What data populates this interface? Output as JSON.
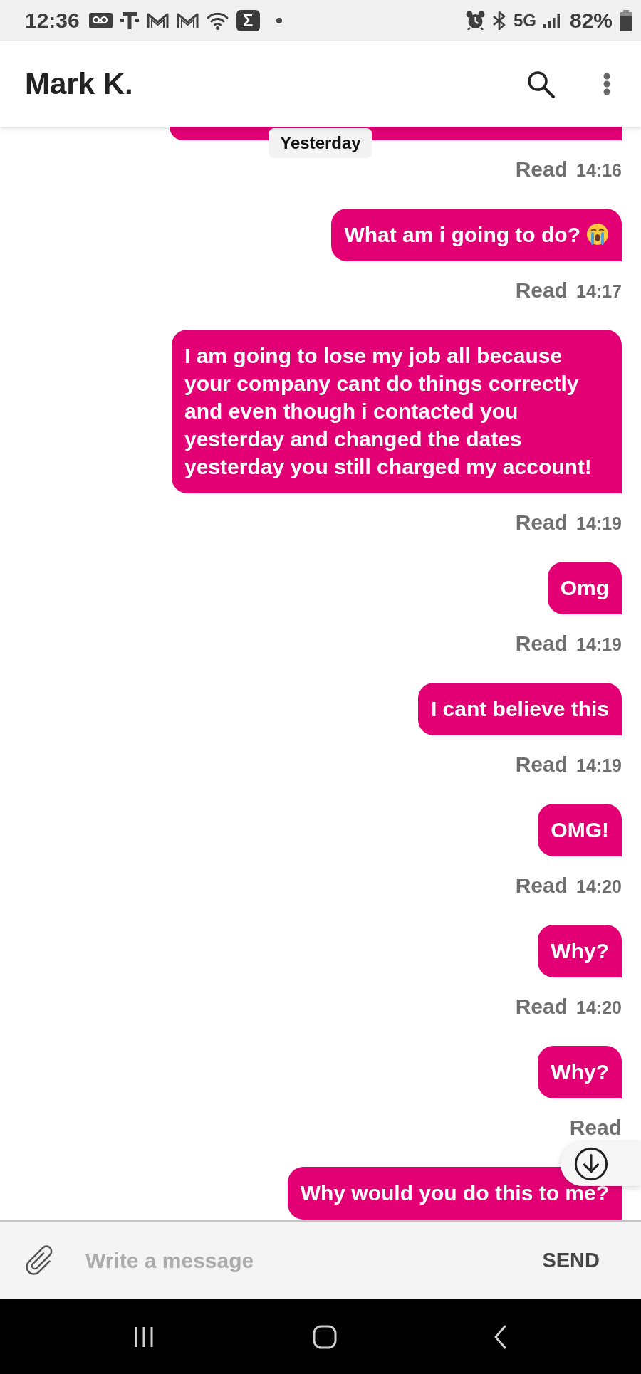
{
  "status_bar": {
    "time": "12:36",
    "app_glyph": "Σ",
    "network": "5G",
    "battery": "82%"
  },
  "header": {
    "title": "Mark K."
  },
  "date_chip": "Yesterday",
  "messages": [
    {
      "kind": "clipped",
      "receipt": "Read",
      "time": "14:16"
    },
    {
      "kind": "text",
      "text": "What am i going to do?",
      "emoji": true,
      "receipt": "Read",
      "time": "14:17"
    },
    {
      "kind": "text",
      "text": "I am going to lose my job all because your company cant do things correctly and even though i contacted you yesterday and changed the dates yesterday you still charged my account!",
      "receipt": "Read",
      "time": "14:19"
    },
    {
      "kind": "text",
      "text": "Omg",
      "receipt": "Read",
      "time": "14:19"
    },
    {
      "kind": "text",
      "text": "I cant believe this",
      "receipt": "Read",
      "time": "14:19"
    },
    {
      "kind": "text",
      "text": "OMG!",
      "receipt": "Read",
      "time": "14:20"
    },
    {
      "kind": "text",
      "text": "Why?",
      "receipt": "Read",
      "time": "14:20"
    },
    {
      "kind": "text",
      "text": "Why?",
      "receipt": "Read"
    },
    {
      "kind": "text",
      "text": "Why would you do this to me?"
    }
  ],
  "composer": {
    "placeholder": "Write a message",
    "send_label": "SEND"
  }
}
